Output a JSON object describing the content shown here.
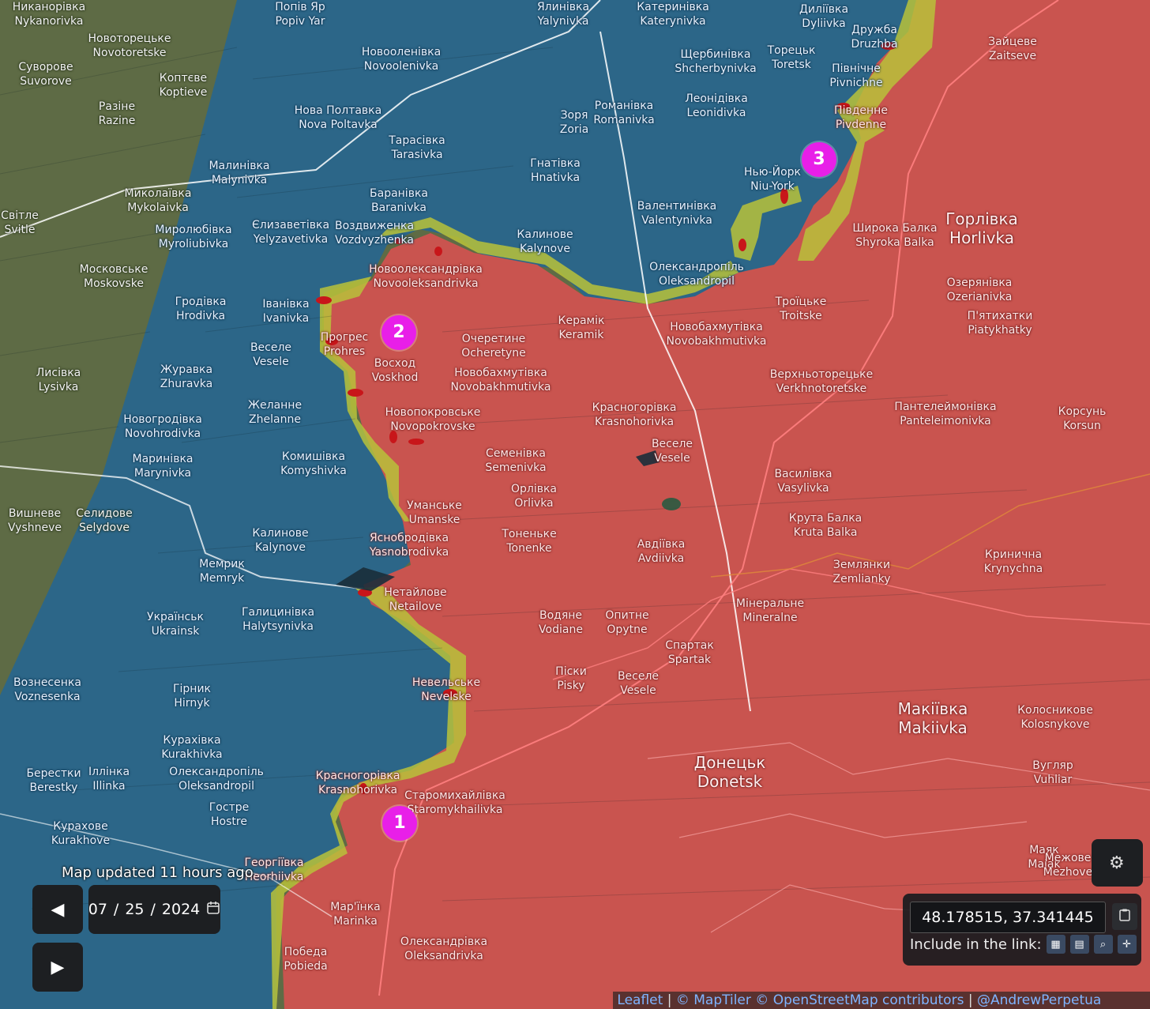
{
  "map": {
    "labels": [
      {
        "uk": "Никанорівка",
        "en": "Nykanorivka",
        "style": "dark"
      },
      {
        "uk": "Новоторецьке",
        "en": "Novotoretske",
        "style": "dark"
      },
      {
        "uk": "Суворове",
        "en": "Suvorove",
        "style": "dark"
      },
      {
        "uk": "Коптєве",
        "en": "Koptieve",
        "style": "dark"
      },
      {
        "uk": "Разіне",
        "en": "Razine",
        "style": "dark"
      },
      {
        "uk": "Миколаївка",
        "en": "Mykolaivka",
        "style": "dark"
      },
      {
        "uk": "Світле",
        "en": "Svitle",
        "style": "dark"
      },
      {
        "uk": "Миролюбівка",
        "en": "Myroliubivka",
        "style": "blue"
      },
      {
        "uk": "Московське",
        "en": "Moskovske",
        "style": "dark"
      },
      {
        "uk": "Гродівка",
        "en": "Hrodivka",
        "style": "blue"
      },
      {
        "uk": "Лисівка",
        "en": "Lysivka",
        "style": "dark"
      },
      {
        "uk": "Журавка",
        "en": "Zhuravka",
        "style": "blue"
      },
      {
        "uk": "Новогродівка",
        "en": "Novohrodivka",
        "style": "blue"
      },
      {
        "uk": "Маринівка",
        "en": "Marynivka",
        "style": "blue"
      },
      {
        "uk": "Вишневе",
        "en": "Vyshneve",
        "style": "dark"
      },
      {
        "uk": "Селидове",
        "en": "Selydove",
        "style": "dark"
      },
      {
        "uk": "Вознесенка",
        "en": "Voznesenka",
        "style": "blue"
      },
      {
        "uk": "Берестки",
        "en": "Berestky",
        "style": "blue"
      },
      {
        "uk": "Іллінка",
        "en": "Illinka",
        "style": "blue"
      },
      {
        "uk": "Курахове",
        "en": "Kurakhove",
        "style": "blue"
      },
      {
        "uk": "Попів Яр",
        "en": "Popiv Yar",
        "style": "blue"
      },
      {
        "uk": "Новооленівка",
        "en": "Novoolenivka",
        "style": "blue"
      },
      {
        "uk": "Нова Полтавка",
        "en": "Nova Poltavka",
        "style": "blue"
      },
      {
        "uk": "Тарасівка",
        "en": "Tarasivka",
        "style": "blue"
      },
      {
        "uk": "Малинівка",
        "en": "Malynivka",
        "style": "blue"
      },
      {
        "uk": "Баранівка",
        "en": "Baranivka",
        "style": "blue"
      },
      {
        "uk": "Єлизаветівка",
        "en": "Yelyzavetivka",
        "style": "blue"
      },
      {
        "uk": "Воздвиженка",
        "en": "Vozdvyzhenka",
        "style": "blue"
      },
      {
        "uk": "Іванівка",
        "en": "Ivanivka",
        "style": "blue"
      },
      {
        "uk": "Веселе",
        "en": "Vesele",
        "style": "blue"
      },
      {
        "uk": "Желанне",
        "en": "Zhelanne",
        "style": "blue"
      },
      {
        "uk": "Комишівка",
        "en": "Komyshivka",
        "style": "blue"
      },
      {
        "uk": "Калинове",
        "en": "Kalynove",
        "style": "blue"
      },
      {
        "uk": "Мемрик",
        "en": "Memryk",
        "style": "blue"
      },
      {
        "uk": "Українськ",
        "en": "Ukrainsk",
        "style": "blue"
      },
      {
        "uk": "Галицинівка",
        "en": "Halytsynivka",
        "style": "blue"
      },
      {
        "uk": "Гірник",
        "en": "Hirnyk",
        "style": "blue"
      },
      {
        "uk": "Курахівка",
        "en": "Kurakhivka",
        "style": "blue"
      },
      {
        "uk": "Олександропіль",
        "en": "Oleksandropil",
        "style": "blue"
      },
      {
        "uk": "Гостре",
        "en": "Hostre",
        "style": "blue"
      },
      {
        "uk": "Ялинівка",
        "en": "Yalynivka",
        "style": "blue"
      },
      {
        "uk": "Зоря",
        "en": "Zoria",
        "style": "blue"
      },
      {
        "uk": "Гнатівка",
        "en": "Hnativka",
        "style": "blue"
      },
      {
        "uk": "Калинове",
        "en": "Kalynove",
        "style": "blue"
      },
      {
        "uk": "Катеринівка",
        "en": "Katerynivka",
        "style": "blue"
      },
      {
        "uk": "Романівка",
        "en": "Romanivka",
        "style": "blue"
      },
      {
        "uk": "Валентинівка",
        "en": "Valentynivka",
        "style": "blue"
      },
      {
        "uk": "Олександропіль",
        "en": "Oleksandropil",
        "style": "blue"
      },
      {
        "uk": "Щербинівка",
        "en": "Shcherbynivka",
        "style": "blue"
      },
      {
        "uk": "Леонідівка",
        "en": "Leonidivka",
        "style": "blue"
      },
      {
        "uk": "Торецьк",
        "en": "Toretsk",
        "style": "blue"
      },
      {
        "uk": "Нью-Йорк",
        "en": "Niu-York",
        "style": "blue"
      },
      {
        "uk": "Дилiївка",
        "en": "Dyliivka",
        "style": "blue"
      },
      {
        "uk": "Дружба",
        "en": "Druzhba",
        "style": "blue"
      },
      {
        "uk": "Північне",
        "en": "Pivnichne",
        "style": "blue"
      },
      {
        "uk": "Південне",
        "en": "Pivdenne",
        "style": "red"
      },
      {
        "uk": "Новоолександрівка",
        "en": "Novooleksandrivka",
        "style": "red"
      },
      {
        "uk": "Прогрес",
        "en": "Prohres",
        "style": "red"
      },
      {
        "uk": "Восход",
        "en": "Voskhod",
        "style": "red"
      },
      {
        "uk": "Очеретине",
        "en": "Ocheretyne",
        "style": "red"
      },
      {
        "uk": "Керамік",
        "en": "Keramik",
        "style": "red"
      },
      {
        "uk": "Новобахмутівка",
        "en": "Novobakhmutivka",
        "style": "red"
      },
      {
        "uk": "Новобахмутівка",
        "en": "Novobakhmutivka",
        "style": "red"
      },
      {
        "uk": "Новопокровське",
        "en": "Novopokrovske",
        "style": "red"
      },
      {
        "uk": "Красногорівка",
        "en": "Krasnohorivka",
        "style": "red"
      },
      {
        "uk": "Веселе",
        "en": "Vesele",
        "style": "red"
      },
      {
        "uk": "Семенівка",
        "en": "Semenivka",
        "style": "red"
      },
      {
        "uk": "Орлівка",
        "en": "Orlivka",
        "style": "red"
      },
      {
        "uk": "Уманське",
        "en": "Umanske",
        "style": "red"
      },
      {
        "uk": "Тоненьке",
        "en": "Tonenke",
        "style": "red"
      },
      {
        "uk": "Яснобродівка",
        "en": "Yasnobrodivka",
        "style": "red"
      },
      {
        "uk": "Авдіївка",
        "en": "Avdiivka",
        "style": "red"
      },
      {
        "uk": "Нетайлове",
        "en": "Netailove",
        "style": "red"
      },
      {
        "uk": "Водяне",
        "en": "Vodiane",
        "style": "red"
      },
      {
        "uk": "Опитне",
        "en": "Opytne",
        "style": "red"
      },
      {
        "uk": "Спартак",
        "en": "Spartak",
        "style": "red"
      },
      {
        "uk": "Піски",
        "en": "Pisky",
        "style": "red"
      },
      {
        "uk": "Веселе",
        "en": "Vesele",
        "style": "red"
      },
      {
        "uk": "Невельське",
        "en": "Nevelske",
        "style": "red"
      },
      {
        "uk": "Красногорівка",
        "en": "Krasnohorivka",
        "style": "red"
      },
      {
        "uk": "Старомихайлівка",
        "en": "Staromykhailivka",
        "style": "red"
      },
      {
        "uk": "Георгіївка",
        "en": "Heorhiivka",
        "style": "red"
      },
      {
        "uk": "Мар'їнка",
        "en": "Marinka",
        "style": "red"
      },
      {
        "uk": "Победа",
        "en": "Pobieda",
        "style": "red"
      },
      {
        "uk": "Олександрівка",
        "en": "Oleksandrivka",
        "style": "red"
      },
      {
        "uk": "Донецьк",
        "en": "Donetsk",
        "style": "red-big"
      },
      {
        "uk": "Макіївка",
        "en": "Makiivka",
        "style": "red-big"
      },
      {
        "uk": "Горлівка",
        "en": "Horlivka",
        "style": "red-big"
      },
      {
        "uk": "Зайцеве",
        "en": "Zaitseve",
        "style": "red"
      },
      {
        "uk": "Широка Балка",
        "en": "Shyroka Balka",
        "style": "red"
      },
      {
        "uk": "Троїцьке",
        "en": "Troitske",
        "style": "red"
      },
      {
        "uk": "Озерянівка",
        "en": "Ozerianivka",
        "style": "red"
      },
      {
        "uk": "П'ятихатки",
        "en": "Piatykhatky",
        "style": "red"
      },
      {
        "uk": "Верхньоторецьке",
        "en": "Verkhnotoretske",
        "style": "red"
      },
      {
        "uk": "Пантелеймонівка",
        "en": "Panteleimonivka",
        "style": "red"
      },
      {
        "uk": "Корсунь",
        "en": "Korsun",
        "style": "red"
      },
      {
        "uk": "Василівка",
        "en": "Vasylivka",
        "style": "red"
      },
      {
        "uk": "Крута Балка",
        "en": "Kruta Balka",
        "style": "red"
      },
      {
        "uk": "Землянки",
        "en": "Zemlianky",
        "style": "red"
      },
      {
        "uk": "Кринична",
        "en": "Krynychna",
        "style": "red"
      },
      {
        "uk": "Мінеральне",
        "en": "Mineralne",
        "style": "red"
      },
      {
        "uk": "Колосникове",
        "en": "Kolosnykove",
        "style": "red"
      },
      {
        "uk": "Вугляр",
        "en": "Vuhliar",
        "style": "red"
      },
      {
        "uk": "Маяк",
        "en": "Maiak",
        "style": "red"
      },
      {
        "uk": "Межове",
        "en": "Mezhove",
        "style": "red"
      }
    ],
    "markers": [
      "1",
      "2",
      "3"
    ],
    "colors": {
      "ukraine_controlled": "#2a6f93",
      "russia_controlled": "#d0504f",
      "contested": "#c9c928",
      "incident": "#d11b1b",
      "marker": "#e81fe8"
    }
  },
  "controls": {
    "updated_text": "Map updated 11 hours ago",
    "prev_icon": "◀",
    "play_icon": "▶",
    "date_month": "07",
    "date_day": "25",
    "date_year": "2024",
    "date_sep": "/",
    "calendar_icon": "calendar-icon"
  },
  "coords": {
    "value": "48.178515, 37.341445",
    "include_label": "Include in the link:"
  },
  "attribution": {
    "leaflet": "Leaflet",
    "sep": "|",
    "maptiler": "© MapTiler",
    "osm": "© OpenStreetMap contributors",
    "author": "@AndrewPerpetua"
  }
}
